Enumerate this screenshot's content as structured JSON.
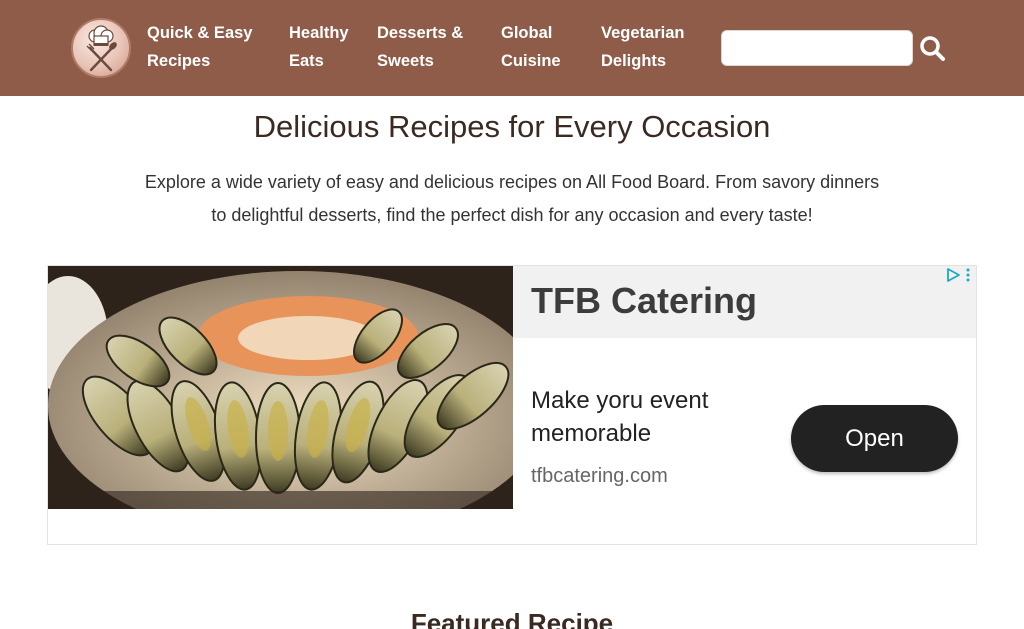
{
  "nav": {
    "items": [
      {
        "line1": "Quick & Easy",
        "line2": "Recipes"
      },
      {
        "line1": "Healthy",
        "line2": "Eats"
      },
      {
        "line1": "Desserts &",
        "line2": "Sweets"
      },
      {
        "line1": "Global",
        "line2": "Cuisine"
      },
      {
        "line1": "Vegetarian",
        "line2": "Delights"
      }
    ],
    "search": {
      "value": "",
      "placeholder": "",
      "icon": "search-icon"
    },
    "logo_icon": "chef-hat-fork-spoon-icon"
  },
  "hero": {
    "title": "Delicious Recipes for Every Occasion",
    "intro_line1": "Explore a wide variety of easy and delicious recipes on All Food Board. From savory dinners",
    "intro_line2": "to delightful desserts, find the perfect dish for any occasion and every taste!"
  },
  "ad": {
    "brand": "TFB Catering",
    "headline": "Make yoru event memorable",
    "url": "tfbcatering.com",
    "cta": "Open",
    "image": "seafood-platter-image",
    "choices_icon": "adchoices-icon",
    "menu_icon": "more-vertical-icon"
  },
  "featured": {
    "heading": "Featured Recipe"
  },
  "colors": {
    "header": "#8e5c48",
    "cta": "#222222",
    "adchoices": "#1aa9c7"
  }
}
